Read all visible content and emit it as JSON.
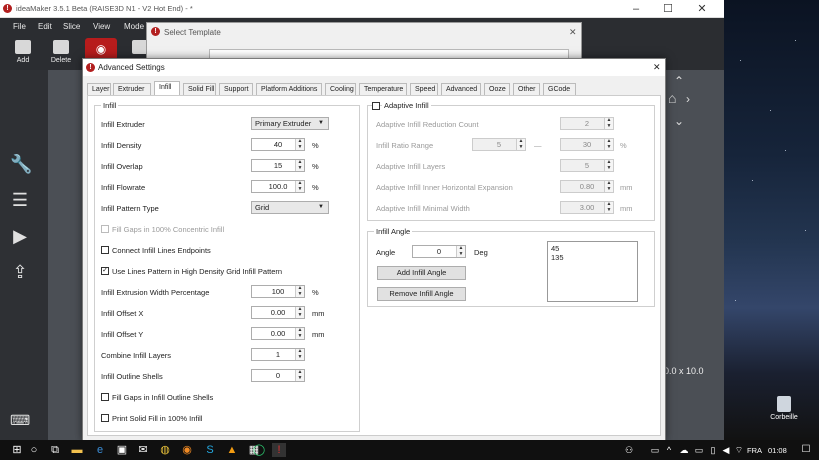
{
  "app": {
    "title": "ideaMaker 3.5.1 Beta (RAISE3D N1 - V2 Hot End) - *",
    "menu": [
      "File",
      "Edit",
      "Slice",
      "View",
      "Mode"
    ],
    "toolbar": [
      "Add",
      "Delete"
    ],
    "side_icons": [
      "wrench-icon",
      "list-icon",
      "play-icon",
      "upload-icon"
    ],
    "viewport_label": "0.0 x 10.0"
  },
  "template_dialog": {
    "title": "Select Template",
    "close": "✕"
  },
  "dialog": {
    "title": "Advanced Settings",
    "close": "✕",
    "tabs": [
      "Layer",
      "Extruder",
      "Infill",
      "Solid Fill",
      "Support",
      "Platform Additions",
      "Cooling",
      "Temperature",
      "Speed",
      "Advanced",
      "Ooze",
      "Other",
      "GCode"
    ],
    "active_tab": "Infill",
    "infill": {
      "group_title": "Infill",
      "extruder": {
        "label": "Infill Extruder",
        "value": "Primary Extruder"
      },
      "density": {
        "label": "Infill Density",
        "value": "40",
        "unit": "%"
      },
      "overlap": {
        "label": "Infill Overlap",
        "value": "15",
        "unit": "%"
      },
      "flowrate": {
        "label": "Infill Flowrate",
        "value": "100.0",
        "unit": "%"
      },
      "pattern": {
        "label": "Infill Pattern Type",
        "value": "Grid"
      },
      "fill_gaps_concentric": "Fill Gaps in 100% Concentric Infill",
      "connect_endpoints": "Connect Infill Lines Endpoints",
      "use_lines_pattern": "Use Lines Pattern in High Density Grid Infill Pattern",
      "extrusion_width": {
        "label": "Infill Extrusion Width Percentage",
        "value": "100",
        "unit": "%"
      },
      "offset_x": {
        "label": "Infill Offset X",
        "value": "0.00",
        "unit": "mm"
      },
      "offset_y": {
        "label": "Infill Offset Y",
        "value": "0.00",
        "unit": "mm"
      },
      "combine_layers": {
        "label": "Combine Infill Layers",
        "value": "1"
      },
      "outline_shells": {
        "label": "Infill Outline Shells",
        "value": "0"
      },
      "fill_gaps_outline": "Fill Gaps in Infill Outline Shells",
      "print_solid_fill": "Print Solid Fill in 100% Infill"
    },
    "adaptive": {
      "title": "Adaptive Infill",
      "reduction_count": {
        "label": "Adaptive Infill Reduction Count",
        "value": "2"
      },
      "ratio_range": {
        "label": "Infill Ratio Range",
        "min": "5",
        "sep": "—",
        "max": "30",
        "unit": "%"
      },
      "layers": {
        "label": "Adaptive Infill Layers",
        "value": "5"
      },
      "inner_expansion": {
        "label": "Adaptive Infill Inner Horizontal Expansion",
        "value": "0.80",
        "unit": "mm"
      },
      "min_width": {
        "label": "Adaptive Infill Minimal Width",
        "value": "3.00",
        "unit": "mm"
      }
    },
    "angle": {
      "group_title": "Infill Angle",
      "label": "Angle",
      "value": "0",
      "unit": "Deg",
      "add_button": "Add Infill Angle",
      "remove_button": "Remove Infill Angle",
      "list": [
        "45",
        "135"
      ]
    }
  },
  "desktop": {
    "recycle_bin": "Corbeille"
  },
  "taskbar": {
    "lang": "FRA",
    "time": "01:08"
  }
}
